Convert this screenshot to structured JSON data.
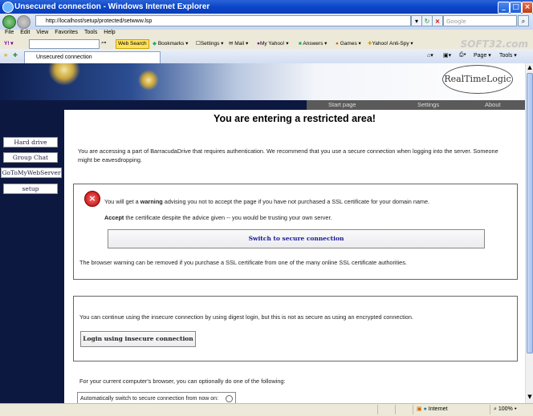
{
  "window": {
    "title": "Unsecured connection - Windows Internet Explorer"
  },
  "address": {
    "url": "http://localhost/setup/protected/setwww.lsp",
    "search_placeholder": "Google"
  },
  "menu": [
    "File",
    "Edit",
    "View",
    "Favorites",
    "Tools",
    "Help"
  ],
  "toolbar": {
    "web_search": "Web Search",
    "bookmarks": "Bookmarks",
    "settings": "Settings",
    "mail": "Mail",
    "my_yahoo": "My Yahoo!",
    "answers": "Answers",
    "games": "Games",
    "antispy": "Yahoo! Anti-Spy",
    "watermark": "SOFT32.com"
  },
  "tab": {
    "label": "Unsecured connection",
    "page_label": "Page",
    "tools_label": "Tools"
  },
  "site": {
    "logo": "RealTimeLogic",
    "nav": [
      "Start page",
      "Settings",
      "About"
    ],
    "sidebar": [
      "Hard drive",
      "Group Chat",
      "GoToMyWebServer",
      "setup"
    ]
  },
  "content": {
    "heading": "You are entering a restricted area!",
    "intro": "You are accessing a part of BarracudaDrive that requires authentication. We recommend that you use a secure connection when logging into the server. Someone might be eavesdropping.",
    "warning_prefix": "You will get a ",
    "warning_bold": "warning",
    "warning_suffix": " advising you not to accept the page if you have not purchased a SSL certificate for your domain name.",
    "accept_bold": "Accept",
    "accept_text": " the certificate despite the advice given -- you would be trusting your own server.",
    "secure_button": "Switch to secure connection",
    "ssl_note": "The browser warning can be removed if you purchase a SSL certificate from one of the many online SSL certificate authorities.",
    "insecure_note": "You can continue using the insecure connection by using digest login, but this is not as secure as using an encrypted connection.",
    "insecure_button": "Login using insecure connection",
    "options_note": "For your current computer's browser, you can optionally do one of the following:",
    "auto_switch": "Automatically switch to secure connection from now on:"
  },
  "status": {
    "zone": "Internet",
    "zoom": "100%"
  }
}
